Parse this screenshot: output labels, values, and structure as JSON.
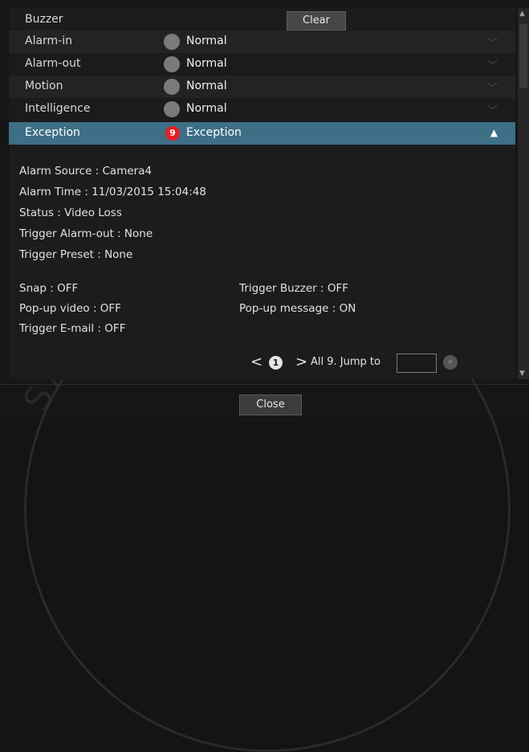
{
  "buzzer": {
    "label": "Buzzer",
    "clear_label": "Clear"
  },
  "rows": [
    {
      "title": "Alarm-in",
      "status": "Normal"
    },
    {
      "title": "Alarm-out",
      "status": "Normal"
    },
    {
      "title": "Motion",
      "status": "Normal"
    },
    {
      "title": "Intelligence",
      "status": "Normal"
    }
  ],
  "exception_row": {
    "title": "Exception",
    "count": "9",
    "status": "Exception"
  },
  "details": {
    "alarm_source": "Alarm Source : Camera4",
    "alarm_time": "Alarm Time : 11/03/2015 15:04:48",
    "status": "Status : Video Loss",
    "trigger_alarm_out": "Trigger Alarm-out : None",
    "trigger_preset": "Trigger Preset : None",
    "snap": "Snap : OFF",
    "trigger_buzzer": "Trigger Buzzer : OFF",
    "popup_video": "Pop-up video : OFF",
    "popup_message": "Pop-up message : ON",
    "trigger_email": "Trigger E-mail : OFF"
  },
  "pager": {
    "prev": "<",
    "current": "1",
    "next": ">",
    "all_text": "All 9. Jump to",
    "jump_value": ""
  },
  "close_label": "Close",
  "colors": {
    "selected_row": "#3d6f86",
    "badge": "#e51e25",
    "background": "#161616"
  },
  "icons": {
    "expand": "chevron-down-icon",
    "collapse": "chevron-up-icon",
    "go": "go-icon"
  }
}
